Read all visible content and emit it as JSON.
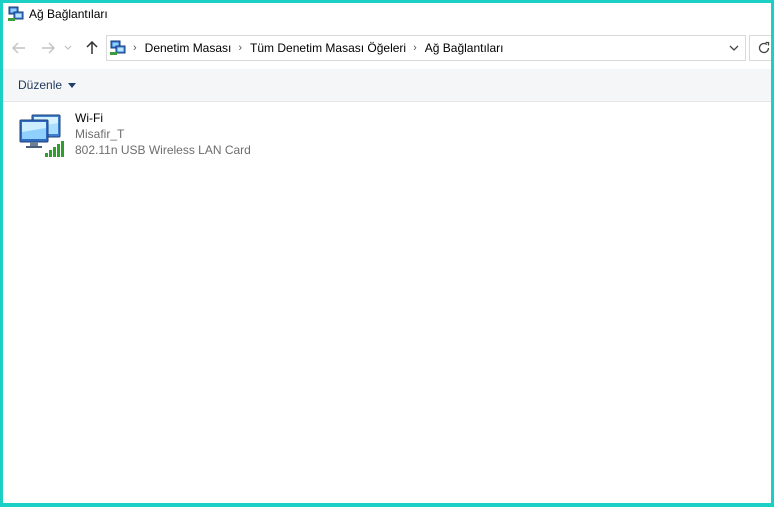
{
  "window": {
    "title": "Ağ Bağlantıları",
    "icon": "network-connections-icon"
  },
  "navigation": {
    "back_icon": "arrow-left-icon",
    "forward_icon": "arrow-right-icon",
    "recent_icon": "chevron-down-icon",
    "up_icon": "arrow-up-icon",
    "breadcrumb": [
      "Denetim Masası",
      "Tüm Denetim Masası Öğeleri",
      "Ağ Bağlantıları"
    ],
    "dropdown_icon": "chevron-down-icon",
    "refresh_icon": "refresh-icon"
  },
  "commandbar": {
    "organize_label": "Düzenle"
  },
  "connections": [
    {
      "name": "Wi-Fi",
      "network": "Misafir_T",
      "adapter": "802.11n USB Wireless LAN Card",
      "icon": "wifi-adapter-icon",
      "signal_bars": 5
    }
  ],
  "colors": {
    "frame": "#1ccfc4",
    "commandbar_bg": "#f5f6f7",
    "signal_green": "#2f9e2f"
  }
}
